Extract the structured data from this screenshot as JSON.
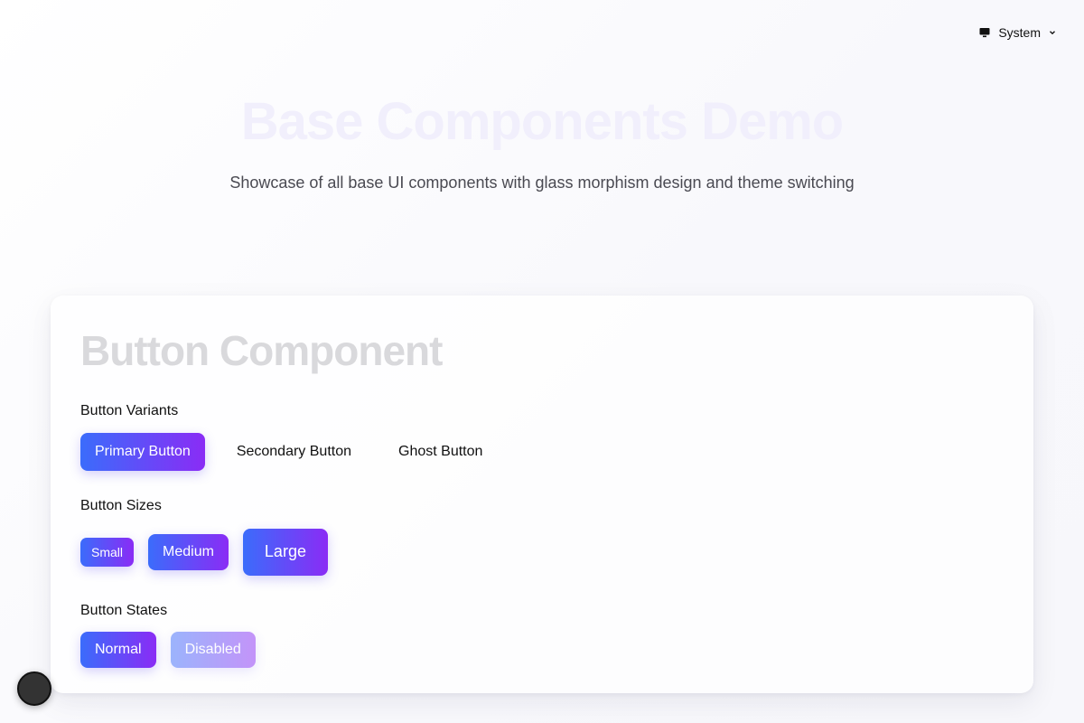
{
  "theme": {
    "label": "System",
    "icon": "monitor-icon"
  },
  "hero": {
    "title": "Base Components Demo",
    "subtitle": "Showcase of all base UI components with glass morphism design and theme switching"
  },
  "card": {
    "title": "Button Component",
    "variants": {
      "label": "Button Variants",
      "primary": "Primary Button",
      "secondary": "Secondary Button",
      "ghost": "Ghost Button"
    },
    "sizes": {
      "label": "Button Sizes",
      "small": "Small",
      "medium": "Medium",
      "large": "Large"
    },
    "states": {
      "label": "Button States",
      "normal": "Normal",
      "disabled": "Disabled"
    }
  },
  "colors": {
    "gradient_start": "#3b6cfb",
    "gradient_end": "#8a2cf5"
  }
}
